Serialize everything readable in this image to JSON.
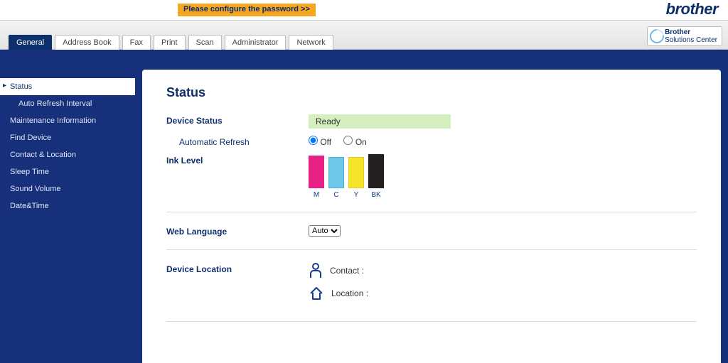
{
  "header": {
    "password_banner": "Please configure the password >>",
    "brand": "brother",
    "solutions_center_line1": "Brother",
    "solutions_center_line2": "Solutions Center"
  },
  "tabs": {
    "items": [
      {
        "label": "General",
        "active": true
      },
      {
        "label": "Address Book",
        "active": false
      },
      {
        "label": "Fax",
        "active": false
      },
      {
        "label": "Print",
        "active": false
      },
      {
        "label": "Scan",
        "active": false
      },
      {
        "label": "Administrator",
        "active": false
      },
      {
        "label": "Network",
        "active": false
      }
    ]
  },
  "sidebar": {
    "items": [
      {
        "label": "Status",
        "active": true,
        "sub": false
      },
      {
        "label": "Auto Refresh Interval",
        "active": false,
        "sub": true
      },
      {
        "label": "Maintenance Information",
        "active": false,
        "sub": false
      },
      {
        "label": "Find Device",
        "active": false,
        "sub": false
      },
      {
        "label": "Contact & Location",
        "active": false,
        "sub": false
      },
      {
        "label": "Sleep Time",
        "active": false,
        "sub": false
      },
      {
        "label": "Sound Volume",
        "active": false,
        "sub": false
      },
      {
        "label": "Date&Time",
        "active": false,
        "sub": false
      }
    ]
  },
  "page": {
    "title": "Status",
    "labels": {
      "device_status": "Device Status",
      "automatic_refresh": "Automatic Refresh",
      "ink_level": "Ink Level",
      "web_language": "Web Language",
      "device_location": "Device Location"
    },
    "device_status": "Ready",
    "automatic_refresh": {
      "off": "Off",
      "on": "On",
      "selected": "Off"
    },
    "ink": {
      "m": "M",
      "c": "C",
      "y": "Y",
      "bk": "BK"
    },
    "web_language": {
      "selected": "Auto",
      "options": [
        "Auto"
      ]
    },
    "location": {
      "contact_label": "Contact :",
      "location_label": "Location :",
      "contact_value": "",
      "location_value": ""
    }
  }
}
